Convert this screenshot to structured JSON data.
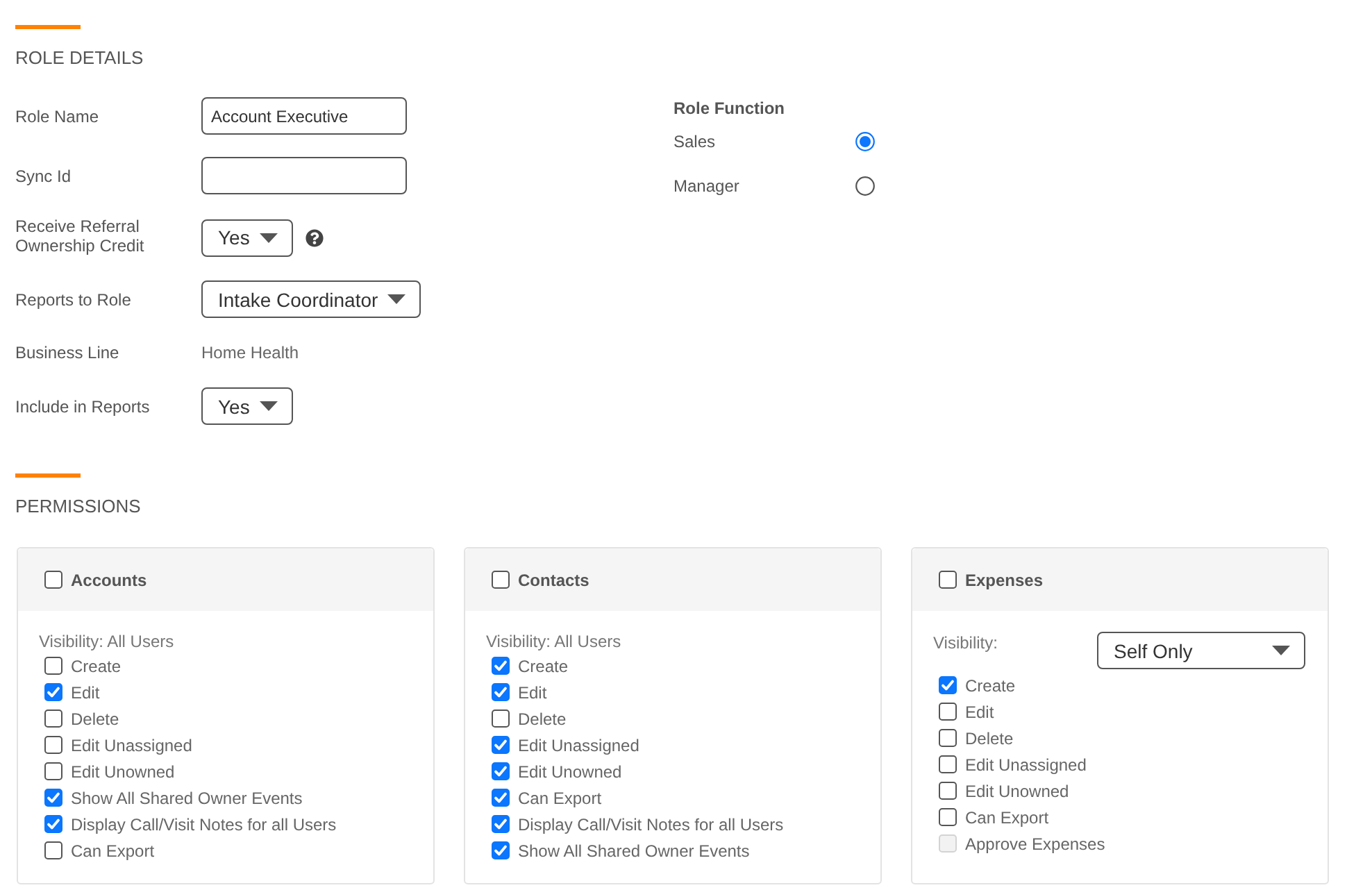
{
  "role_details": {
    "title": "ROLE DETAILS",
    "fields": [
      {
        "kind": "text",
        "label": "Role Name",
        "value": "Account Executive"
      },
      {
        "kind": "text",
        "label": "Sync Id"
      },
      {
        "kind": "select",
        "label": "Receive Referral Ownership Credit",
        "value": "Yes",
        "help": true
      },
      {
        "kind": "select",
        "label": "Reports to Role",
        "value": "Intake Coordinator"
      },
      {
        "kind": "static",
        "label": "Business Line",
        "value": "Home Health"
      },
      {
        "kind": "select",
        "label": "Include in Reports",
        "value": "Yes"
      }
    ]
  },
  "role_function": {
    "title": "Role Function",
    "options": [
      {
        "label": "Sales",
        "selected": true
      },
      {
        "label": "Manager",
        "selected": false
      }
    ]
  },
  "permissions": {
    "title": "PERMISSIONS",
    "panels": [
      {
        "title": "Accounts",
        "checked": false,
        "visibility": {
          "kind": "text",
          "text": "Visibility: All Users"
        },
        "items": [
          {
            "label": "Create",
            "checked": false,
            "disabled": false
          },
          {
            "label": "Edit",
            "checked": true,
            "disabled": false
          },
          {
            "label": "Delete",
            "checked": false,
            "disabled": false
          },
          {
            "label": "Edit Unassigned",
            "checked": false,
            "disabled": false
          },
          {
            "label": "Edit Unowned",
            "checked": false,
            "disabled": false
          },
          {
            "label": "Show All Shared Owner Events",
            "checked": true,
            "disabled": false
          },
          {
            "label": "Display Call/Visit Notes for all Users",
            "checked": true,
            "disabled": false
          },
          {
            "label": "Can Export",
            "checked": false,
            "disabled": false
          }
        ]
      },
      {
        "title": "Contacts",
        "checked": false,
        "visibility": {
          "kind": "text",
          "text": "Visibility: All Users"
        },
        "items": [
          {
            "label": "Create",
            "checked": true,
            "disabled": false
          },
          {
            "label": "Edit",
            "checked": true,
            "disabled": false
          },
          {
            "label": "Delete",
            "checked": false,
            "disabled": false
          },
          {
            "label": "Edit Unassigned",
            "checked": true,
            "disabled": false
          },
          {
            "label": "Edit Unowned",
            "checked": true,
            "disabled": false
          },
          {
            "label": "Can Export",
            "checked": true,
            "disabled": false
          },
          {
            "label": "Display Call/Visit Notes for all Users",
            "checked": true,
            "disabled": false
          },
          {
            "label": "Show All Shared Owner Events",
            "checked": true,
            "disabled": false
          }
        ]
      },
      {
        "title": "Expenses",
        "checked": false,
        "visibility": {
          "kind": "select",
          "label": "Visibility:",
          "value": "Self Only"
        },
        "items": [
          {
            "label": "Create",
            "checked": true,
            "disabled": false
          },
          {
            "label": "Edit",
            "checked": false,
            "disabled": false
          },
          {
            "label": "Delete",
            "checked": false,
            "disabled": false
          },
          {
            "label": "Edit Unassigned",
            "checked": false,
            "disabled": false
          },
          {
            "label": "Edit Unowned",
            "checked": false,
            "disabled": false
          },
          {
            "label": "Can Export",
            "checked": false,
            "disabled": false
          },
          {
            "label": "Approve Expenses",
            "checked": false,
            "disabled": true
          }
        ]
      }
    ]
  }
}
